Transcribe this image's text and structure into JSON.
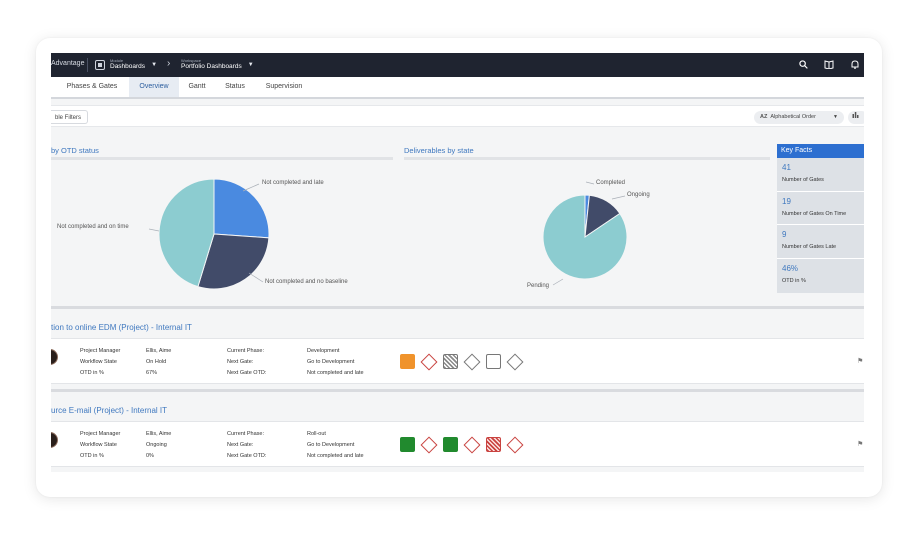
{
  "topbar": {
    "brand": "Advantage",
    "module_small": "Module",
    "module_name": "Dashboards",
    "workspace_small": "Workspace",
    "workspace_name": "Portfolio Dashboards"
  },
  "tabs": [
    {
      "label": "Phases & Gates",
      "active": false
    },
    {
      "label": "Overview",
      "active": true
    },
    {
      "label": "Gantt",
      "active": false
    },
    {
      "label": "Status",
      "active": false
    },
    {
      "label": "Supervision",
      "active": false
    }
  ],
  "filters": {
    "filter_label": "ble Filters",
    "sort_icon": "AZ",
    "sort_label": "Alphabetical Order"
  },
  "panels": {
    "otd_title": "by OTD status",
    "deliv_title": "Deliverables by state"
  },
  "otd_pie": {
    "slices": [
      {
        "label": "Not completed and late",
        "color": "#4a8ae0",
        "start": 0,
        "end": 94
      },
      {
        "label": "Not completed and no baseline",
        "color": "#414b69",
        "start": 94,
        "end": 197
      },
      {
        "label": "Not completed and on time",
        "color": "#8cccd0",
        "start": 197,
        "end": 360
      }
    ]
  },
  "deliv_pie": {
    "slices": [
      {
        "label": "Completed",
        "color": "#4a8ae0",
        "start": 0,
        "end": 6
      },
      {
        "label": "Ongoing",
        "color": "#414b69",
        "start": 6,
        "end": 56
      },
      {
        "label": "Pending",
        "color": "#8cccd0",
        "start": 56,
        "end": 360
      }
    ]
  },
  "key_facts": {
    "title": "Key Facts",
    "items": [
      {
        "value": "41",
        "label": "Number of Gates"
      },
      {
        "value": "19",
        "label": "Number of Gates On Time"
      },
      {
        "value": "9",
        "label": "Number of Gates Late"
      },
      {
        "value": "46%",
        "label": "OTD in %"
      }
    ]
  },
  "projects": [
    {
      "title": "tion to online EDM (Project) - Internal IT",
      "fields": [
        {
          "label": "Project Manager",
          "value": "Ellis, Aime"
        },
        {
          "label": "Workflow State",
          "value": "On Hold"
        },
        {
          "label": "OTD in %",
          "value": "67%"
        }
      ],
      "phase_fields": [
        {
          "label": "Current Phase:",
          "value": "Development"
        },
        {
          "label": "Next Gate:",
          "value": "Go to Development"
        },
        {
          "label": "Next Gate OTD:",
          "value": "Not completed and late"
        }
      ],
      "gates": [
        {
          "shape": "square",
          "style": "orange"
        },
        {
          "shape": "diamond",
          "style": "red-outline"
        },
        {
          "shape": "square",
          "style": "grey-hatched"
        },
        {
          "shape": "diamond",
          "style": "grey-outline"
        },
        {
          "shape": "square",
          "style": "grey-outline"
        },
        {
          "shape": "diamond",
          "style": "grey-outline"
        }
      ]
    },
    {
      "title": "urce E-mail (Project) - Internal IT",
      "fields": [
        {
          "label": "Project Manager",
          "value": "Ellis, Aime"
        },
        {
          "label": "Workflow State",
          "value": "Ongoing"
        },
        {
          "label": "OTD in %",
          "value": "0%"
        }
      ],
      "phase_fields": [
        {
          "label": "Current Phase:",
          "value": "Roll-out"
        },
        {
          "label": "Next Gate:",
          "value": "Go to Development"
        },
        {
          "label": "Next Gate OTD:",
          "value": "Not completed and late"
        }
      ],
      "gates": [
        {
          "shape": "square",
          "style": "green"
        },
        {
          "shape": "diamond",
          "style": "red-outline"
        },
        {
          "shape": "square",
          "style": "green"
        },
        {
          "shape": "diamond",
          "style": "red-outline"
        },
        {
          "shape": "square",
          "style": "red-hatched"
        },
        {
          "shape": "diamond",
          "style": "red-outline"
        }
      ]
    }
  ],
  "colors": {
    "accent": "#3f78bf",
    "topbar": "#1f2430",
    "key_facts_header": "#2d6fd0",
    "gate_orange": "#f0932b",
    "gate_green": "#218a2e",
    "gate_red": "#c9423f",
    "gate_grey": "#777777"
  }
}
